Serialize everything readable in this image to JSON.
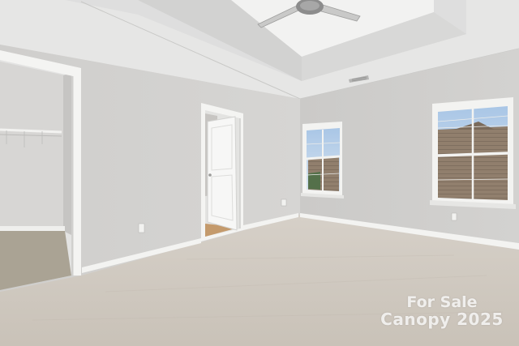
{
  "photo": {
    "subject": "empty bedroom",
    "palette": {
      "wall": "#d4d3d1",
      "wall_shadow": "#c4c3c1",
      "ceiling": "#e8e8e7",
      "tray_ceiling": "#f0f0ef",
      "carpet": "#cdc6bd",
      "trim": "#f4f4f2",
      "closet_floor": "#aaa394",
      "sky": "#b8cfe6",
      "neighbor_house": "#8e7d6c"
    },
    "icons": [
      "ceiling-fan-icon",
      "air-vent-icon",
      "power-outlet-icon"
    ]
  },
  "watermark": {
    "line1": "For Sale",
    "line2": "Canopy 2025"
  }
}
